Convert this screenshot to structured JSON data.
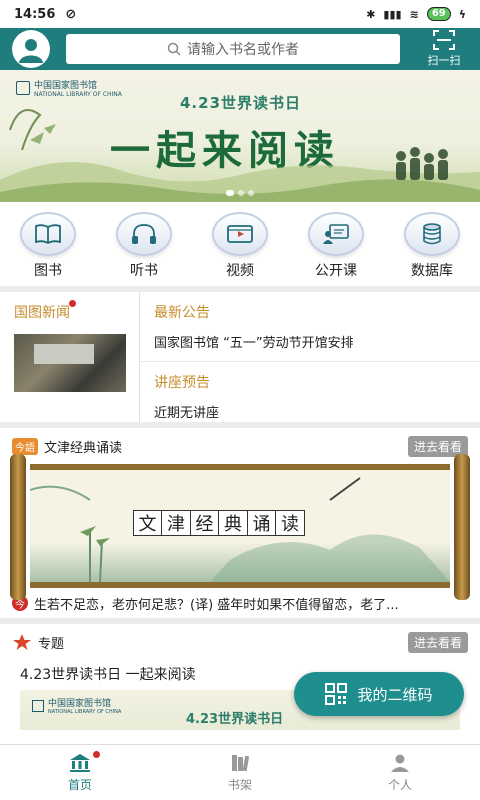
{
  "status_bar": {
    "time": "14:56",
    "battery": "69"
  },
  "header": {
    "search_placeholder": "请输入书名或作者",
    "scan_label": "扫一扫"
  },
  "banner": {
    "logo_text": "中国国家图书馆",
    "logo_en": "NATIONAL LIBRARY OF CHINA",
    "subtitle": "4.23世界读书日",
    "headline": "一起来阅读"
  },
  "quick_nav": [
    {
      "label": "图书",
      "icon": "book-icon"
    },
    {
      "label": "听书",
      "icon": "headphones-icon"
    },
    {
      "label": "视频",
      "icon": "video-icon"
    },
    {
      "label": "公开课",
      "icon": "lecture-icon"
    },
    {
      "label": "数据库",
      "icon": "database-icon"
    }
  ],
  "news": {
    "left_title": "国图新闻",
    "announcement_title": "最新公告",
    "announcement_text": "国家图书馆 “五一”劳动节开馆安排",
    "lecture_title": "讲座预告",
    "lecture_text": "近期无讲座"
  },
  "wenjin": {
    "badge": "今語",
    "title": "文津经典诵读",
    "more": "进去看看",
    "scroll_chars": [
      "文",
      "津",
      "经",
      "典",
      "诵",
      "读"
    ],
    "quote_badge": "今",
    "quote": "生若不足恋，老亦何足悲？(译) 盛年时如果不值得留恋，老了..."
  },
  "topic": {
    "title": "专题",
    "more": "进去看看",
    "text": "4.23世界读书日 一起来阅读",
    "img_logo": "中国国家图书馆",
    "img_logo_en": "NATIONAL LIBRARY OF CHINA",
    "img_sub": "4.23世界读书日"
  },
  "qr_button": "我的二维码",
  "tabbar": [
    {
      "label": "首页",
      "active": true
    },
    {
      "label": "书架",
      "active": false
    },
    {
      "label": "个人",
      "active": false
    }
  ],
  "colors": {
    "primary": "#1f7d7e",
    "accent_gold": "#c68d2b",
    "alert_red": "#d12a2a"
  }
}
